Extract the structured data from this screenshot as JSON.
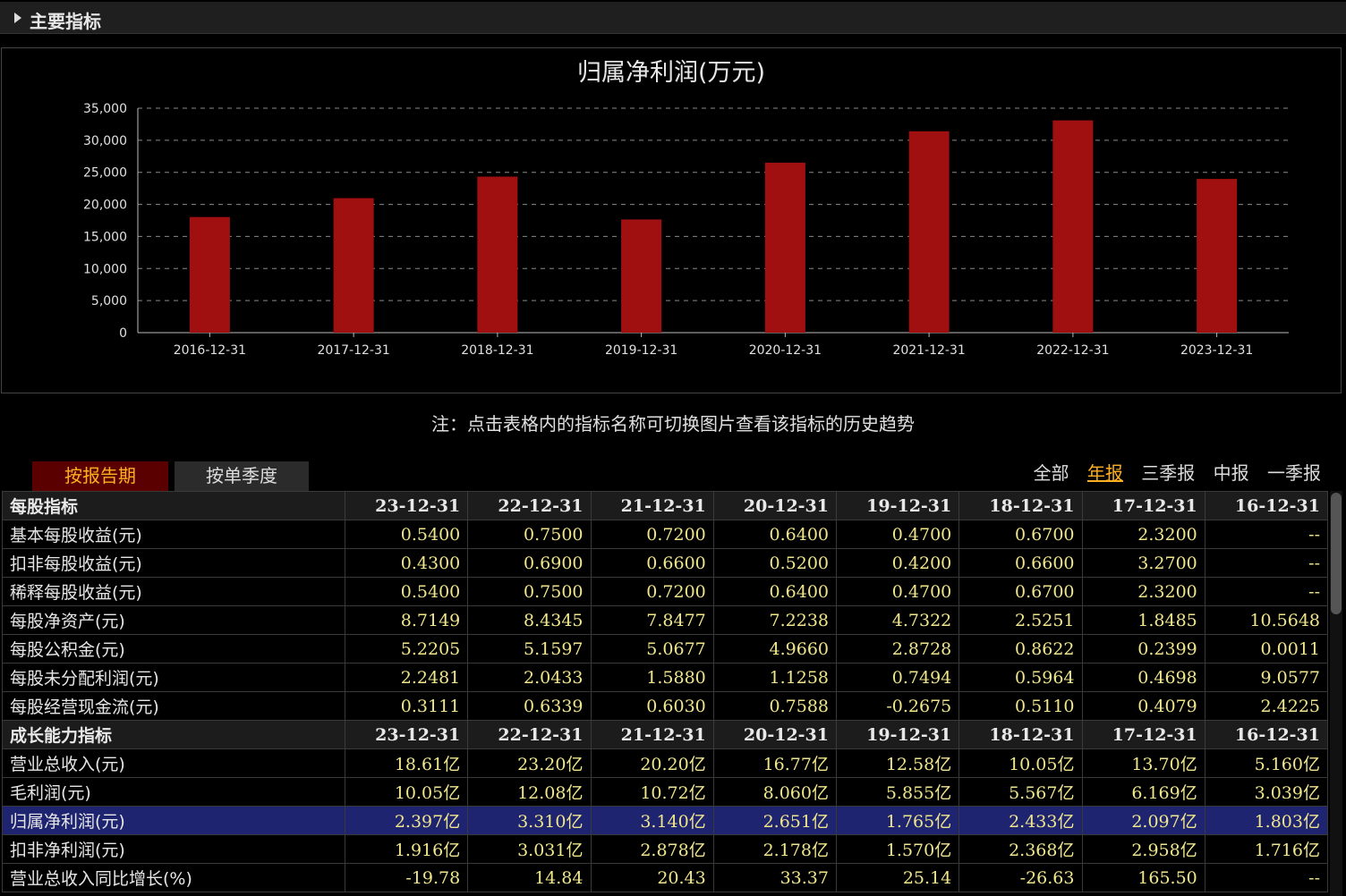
{
  "section": {
    "title": "主要指标"
  },
  "chart_data": {
    "type": "bar",
    "title": "归属净利润(万元)",
    "categories": [
      "2016-12-31",
      "2017-12-31",
      "2018-12-31",
      "2019-12-31",
      "2020-12-31",
      "2021-12-31",
      "2022-12-31",
      "2023-12-31"
    ],
    "values": [
      18030,
      20970,
      24330,
      17650,
      26510,
      31400,
      33100,
      23970
    ],
    "ylim": [
      0,
      35000
    ],
    "yticks": [
      0,
      5000,
      10000,
      15000,
      20000,
      25000,
      30000,
      35000
    ],
    "ytick_labels": [
      "0",
      "5,000",
      "10,000",
      "15,000",
      "20,000",
      "25,000",
      "30,000",
      "35,000"
    ],
    "bar_color": "#a01010",
    "grid": true
  },
  "note": "注：点击表格内的指标名称可切换图片查看该指标的历史趋势",
  "tabs": [
    {
      "label": "按报告期",
      "active": true
    },
    {
      "label": "按单季度",
      "active": false
    }
  ],
  "filters": [
    {
      "label": "全部",
      "active": false
    },
    {
      "label": "年报",
      "active": true
    },
    {
      "label": "三季报",
      "active": false
    },
    {
      "label": "中报",
      "active": false
    },
    {
      "label": "一季报",
      "active": false
    }
  ],
  "table": {
    "sections": [
      {
        "header": [
          "每股指标",
          "23-12-31",
          "22-12-31",
          "21-12-31",
          "20-12-31",
          "19-12-31",
          "18-12-31",
          "17-12-31",
          "16-12-31"
        ],
        "rows": [
          {
            "name": "基本每股收益(元)",
            "values": [
              "0.5400",
              "0.7500",
              "0.7200",
              "0.6400",
              "0.4700",
              "0.6700",
              "2.3200",
              "--"
            ]
          },
          {
            "name": "扣非每股收益(元)",
            "values": [
              "0.4300",
              "0.6900",
              "0.6600",
              "0.5200",
              "0.4200",
              "0.6600",
              "3.2700",
              "--"
            ]
          },
          {
            "name": "稀释每股收益(元)",
            "values": [
              "0.5400",
              "0.7500",
              "0.7200",
              "0.6400",
              "0.4700",
              "0.6700",
              "2.3200",
              "--"
            ]
          },
          {
            "name": "每股净资产(元)",
            "values": [
              "8.7149",
              "8.4345",
              "7.8477",
              "7.2238",
              "4.7322",
              "2.5251",
              "1.8485",
              "10.5648"
            ]
          },
          {
            "name": "每股公积金(元)",
            "values": [
              "5.2205",
              "5.1597",
              "5.0677",
              "4.9660",
              "2.8728",
              "0.8622",
              "0.2399",
              "0.0011"
            ]
          },
          {
            "name": "每股未分配利润(元)",
            "values": [
              "2.2481",
              "2.0433",
              "1.5880",
              "1.1258",
              "0.7494",
              "0.5964",
              "0.4698",
              "9.0577"
            ]
          },
          {
            "name": "每股经营现金流(元)",
            "values": [
              "0.3111",
              "0.6339",
              "0.6030",
              "0.7588",
              "-0.2675",
              "0.5110",
              "0.4079",
              "2.4225"
            ]
          }
        ]
      },
      {
        "header": [
          "成长能力指标",
          "23-12-31",
          "22-12-31",
          "21-12-31",
          "20-12-31",
          "19-12-31",
          "18-12-31",
          "17-12-31",
          "16-12-31"
        ],
        "rows": [
          {
            "name": "营业总收入(元)",
            "values": [
              "18.61亿",
              "23.20亿",
              "20.20亿",
              "16.77亿",
              "12.58亿",
              "10.05亿",
              "13.70亿",
              "5.160亿"
            ]
          },
          {
            "name": "毛利润(元)",
            "values": [
              "10.05亿",
              "12.08亿",
              "10.72亿",
              "8.060亿",
              "5.855亿",
              "5.567亿",
              "6.169亿",
              "3.039亿"
            ]
          },
          {
            "name": "归属净利润(元)",
            "values": [
              "2.397亿",
              "3.310亿",
              "3.140亿",
              "2.651亿",
              "1.765亿",
              "2.433亿",
              "2.097亿",
              "1.803亿"
            ],
            "highlight": true
          },
          {
            "name": "扣非净利润(元)",
            "values": [
              "1.916亿",
              "3.031亿",
              "2.878亿",
              "2.178亿",
              "1.570亿",
              "2.368亿",
              "2.958亿",
              "1.716亿"
            ]
          },
          {
            "name": "营业总收入同比增长(%)",
            "values": [
              "-19.78",
              "14.84",
              "20.43",
              "33.37",
              "25.14",
              "-26.63",
              "165.50",
              "--"
            ]
          }
        ]
      }
    ]
  }
}
